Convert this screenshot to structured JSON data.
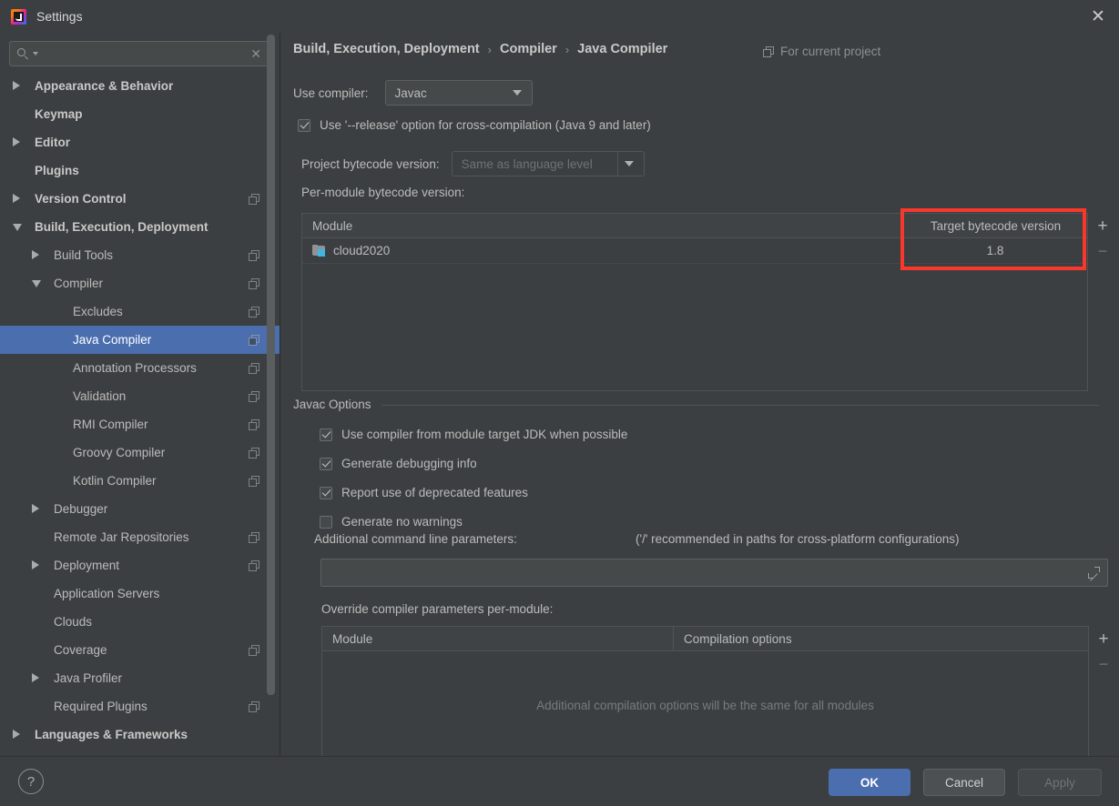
{
  "window": {
    "title": "Settings",
    "app_icon": "intellij-idea-icon",
    "close_icon": "close-icon"
  },
  "sidebar": {
    "search": {
      "value": "",
      "placeholder": "",
      "icon": "search-icon",
      "clear_icon": "clear-icon"
    },
    "items": [
      {
        "label": "Appearance & Behavior",
        "indent": 0,
        "arrow": "right",
        "bold": true,
        "copy": false,
        "selected": false
      },
      {
        "label": "Keymap",
        "indent": 0,
        "arrow": "none",
        "bold": true,
        "copy": false,
        "selected": false
      },
      {
        "label": "Editor",
        "indent": 0,
        "arrow": "right",
        "bold": true,
        "copy": false,
        "selected": false
      },
      {
        "label": "Plugins",
        "indent": 0,
        "arrow": "none",
        "bold": true,
        "copy": false,
        "selected": false
      },
      {
        "label": "Version Control",
        "indent": 0,
        "arrow": "right",
        "bold": true,
        "copy": true,
        "selected": false
      },
      {
        "label": "Build, Execution, Deployment",
        "indent": 0,
        "arrow": "down",
        "bold": true,
        "copy": false,
        "selected": false
      },
      {
        "label": "Build Tools",
        "indent": 1,
        "arrow": "right",
        "bold": false,
        "copy": true,
        "selected": false
      },
      {
        "label": "Compiler",
        "indent": 1,
        "arrow": "down",
        "bold": false,
        "copy": true,
        "selected": false
      },
      {
        "label": "Excludes",
        "indent": 2,
        "arrow": "none",
        "bold": false,
        "copy": true,
        "selected": false
      },
      {
        "label": "Java Compiler",
        "indent": 2,
        "arrow": "none",
        "bold": false,
        "copy": true,
        "selected": true
      },
      {
        "label": "Annotation Processors",
        "indent": 2,
        "arrow": "none",
        "bold": false,
        "copy": true,
        "selected": false
      },
      {
        "label": "Validation",
        "indent": 2,
        "arrow": "none",
        "bold": false,
        "copy": true,
        "selected": false
      },
      {
        "label": "RMI Compiler",
        "indent": 2,
        "arrow": "none",
        "bold": false,
        "copy": true,
        "selected": false
      },
      {
        "label": "Groovy Compiler",
        "indent": 2,
        "arrow": "none",
        "bold": false,
        "copy": true,
        "selected": false
      },
      {
        "label": "Kotlin Compiler",
        "indent": 2,
        "arrow": "none",
        "bold": false,
        "copy": true,
        "selected": false
      },
      {
        "label": "Debugger",
        "indent": 1,
        "arrow": "right",
        "bold": false,
        "copy": false,
        "selected": false
      },
      {
        "label": "Remote Jar Repositories",
        "indent": 1,
        "arrow": "none",
        "bold": false,
        "copy": true,
        "selected": false
      },
      {
        "label": "Deployment",
        "indent": 1,
        "arrow": "right",
        "bold": false,
        "copy": true,
        "selected": false
      },
      {
        "label": "Application Servers",
        "indent": 1,
        "arrow": "none",
        "bold": false,
        "copy": false,
        "selected": false
      },
      {
        "label": "Clouds",
        "indent": 1,
        "arrow": "none",
        "bold": false,
        "copy": false,
        "selected": false
      },
      {
        "label": "Coverage",
        "indent": 1,
        "arrow": "none",
        "bold": false,
        "copy": true,
        "selected": false
      },
      {
        "label": "Java Profiler",
        "indent": 1,
        "arrow": "right",
        "bold": false,
        "copy": false,
        "selected": false
      },
      {
        "label": "Required Plugins",
        "indent": 1,
        "arrow": "none",
        "bold": false,
        "copy": true,
        "selected": false
      },
      {
        "label": "Languages & Frameworks",
        "indent": 0,
        "arrow": "right",
        "bold": true,
        "copy": false,
        "selected": false
      }
    ]
  },
  "main": {
    "breadcrumb": {
      "part1": "Build, Execution, Deployment",
      "sep1": "›",
      "part2": "Compiler",
      "sep2": "›",
      "part3": "Java Compiler"
    },
    "for_current_project": "For current project",
    "use_compiler": {
      "label": "Use compiler:",
      "value": "Javac"
    },
    "release_option": {
      "label": "Use '--release' option for cross-compilation (Java 9 and later)",
      "checked": true
    },
    "project_bytecode": {
      "label": "Project bytecode version:",
      "value": "Same as language level",
      "disabled": true
    },
    "per_module_label": "Per-module bytecode version:",
    "module_table": {
      "columns": [
        "Module",
        "Target bytecode version"
      ],
      "rows": [
        {
          "module": "cloud2020",
          "target": "1.8",
          "icon": "module-folder-icon"
        }
      ],
      "add_label": "+",
      "remove_label": "−"
    },
    "javac_options": {
      "group_title": "Javac Options",
      "checkboxes": [
        {
          "label": "Use compiler from module target JDK when possible",
          "checked": true
        },
        {
          "label": "Generate debugging info",
          "checked": true
        },
        {
          "label": "Report use of deprecated features",
          "checked": true
        },
        {
          "label": "Generate no warnings",
          "checked": false
        }
      ],
      "additional_params_label": "Additional command line parameters:",
      "additional_params_hint": "('/' recommended in paths for cross-platform configurations)",
      "additional_params_value": "",
      "expand_icon": "expand-icon"
    },
    "override_label": "Override compiler parameters per-module:",
    "override_table": {
      "columns": [
        "Module",
        "Compilation options"
      ],
      "empty_message": "Additional compilation options will be the same for all modules",
      "add_label": "+",
      "remove_label": "−"
    }
  },
  "footer": {
    "help_label": "?",
    "ok_label": "OK",
    "cancel_label": "Cancel",
    "apply_label": "Apply"
  },
  "annotation": {
    "color": "#f9372a",
    "shape": "rectangle"
  },
  "colors": {
    "background": "#3c3f41",
    "selection": "#4b6eaf",
    "accent": "#4b6eaf",
    "module_icon": "#40b6e0",
    "annotation": "#f9372a"
  }
}
